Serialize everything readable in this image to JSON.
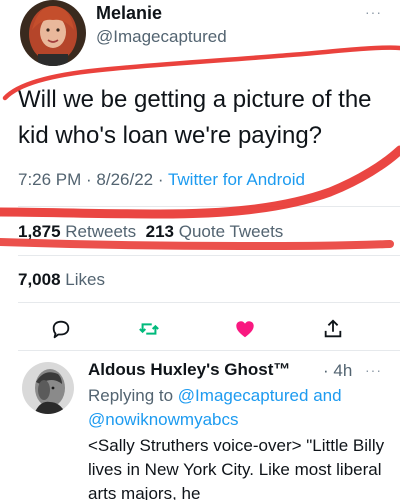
{
  "tweet": {
    "author": {
      "display_name": "Melanie",
      "handle": "@Imagecaptured",
      "avatar_icon": "profile-photo-woman-red-hair"
    },
    "text": "Will we be getting a picture of the kid who's loan we're paying?",
    "timestamp": "7:26 PM · 8/26/22 ·",
    "source": "Twitter for Android",
    "stats": {
      "retweets_count": "1,875",
      "retweets_label": "Retweets",
      "quotes_count": "213",
      "quotes_label": "Quote Tweets",
      "likes_count": "7,008",
      "likes_label": "Likes"
    },
    "actions": [
      {
        "name": "reply-icon"
      },
      {
        "name": "retweet-icon"
      },
      {
        "name": "like-heart-icon"
      },
      {
        "name": "share-icon"
      }
    ],
    "more_label": "···"
  },
  "reply": {
    "display_name": "Aldous Huxley's Ghost™",
    "time": "· 4h",
    "replying_prefix": "Replying to",
    "mention_1": "@Imagecaptured",
    "and_word": "and",
    "mention_2": "@nowiknowmyabcs",
    "text": "<Sally Struthers voice-over> \"Little Billy lives in New York City. Like most liberal arts majors, he",
    "avatar_icon": "profile-photo-bw-man",
    "more_label": "···"
  },
  "colors": {
    "link_blue": "#1d9bf0",
    "muted_gray": "#536471",
    "like_pink": "#f91880",
    "retweet_green": "#00ba7c",
    "annotation_red": "#e8322d"
  }
}
